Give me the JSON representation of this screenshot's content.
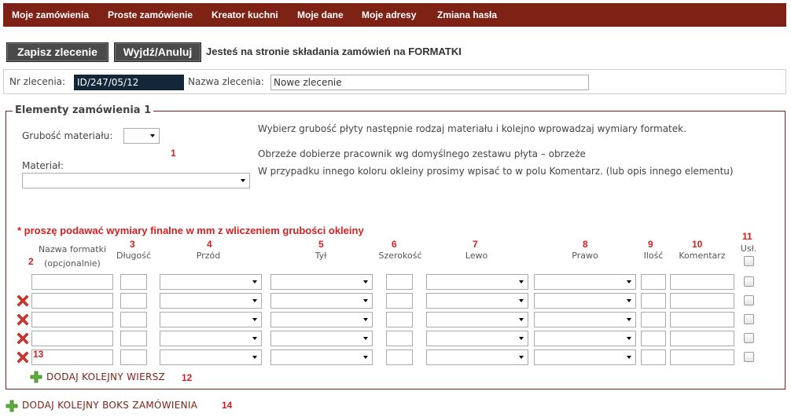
{
  "nav": [
    "Moje zamówienia",
    "Proste zamówienie",
    "Kreator kuchni",
    "Moje dane",
    "Moje adresy",
    "Zmiana hasła"
  ],
  "toolbar": {
    "save_label": "Zapisz zlecenie",
    "exit_label": "Wyjdź/Anuluj",
    "message": "Jesteś na stronie składania zamówień na FORMATKI"
  },
  "order": {
    "number_label": "Nr zlecenia:",
    "number_value": "ID/247/05/12",
    "name_label": "Nazwa zlecenia:",
    "name_value": "Nowe zlecenie"
  },
  "section": {
    "legend": "Elementy zamówienia 1",
    "thickness_label": "Grubość materiału:",
    "material_label": "Materiał:",
    "info": [
      "Wybierz grubość płyty następnie rodzaj materiału i kolejno wprowadzaj wymiary formatek.",
      "Obrzeże dobierze pracownik wg domyślnego zestawu płyta – obrzeże",
      "W przypadku innego koloru okleiny prosimy wpisać to w polu Komentarz. (lub opis innego elementu)"
    ],
    "notice": "* proszę podawać wymiary finalne w mm z wliczeniem grubości okleiny"
  },
  "columns": {
    "name_line1": "Nazwa formatki",
    "name_line2": "(opcjonalnie)",
    "length": "Długość",
    "front": "Przód",
    "back": "Tył",
    "width": "Szerokość",
    "left": "Lewo",
    "right": "Prawo",
    "qty": "Ilość",
    "comment": "Komentarz",
    "service": "Usł."
  },
  "markers": {
    "m1": "1",
    "m2": "2",
    "m3": "3",
    "m4": "4",
    "m5": "5",
    "m6": "6",
    "m7": "7",
    "m8": "8",
    "m9": "9",
    "m10": "10",
    "m11": "11",
    "m12": "12",
    "m13": "13",
    "m14": "14"
  },
  "rows": [
    {
      "deletable": false
    },
    {
      "deletable": true
    },
    {
      "deletable": true
    },
    {
      "deletable": true
    },
    {
      "deletable": true
    }
  ],
  "add_row_label": "DODAJ KOLEJNY WIERSZ",
  "add_box_label": "DODAJ KOLEJNY BOKS ZAMÓWIENIA",
  "colors": {
    "brand": "#7f2216",
    "marker": "#d21f1f",
    "button": "#4a4a4a"
  },
  "icons": {
    "delete": "red-x-icon",
    "add": "green-plus-icon"
  }
}
